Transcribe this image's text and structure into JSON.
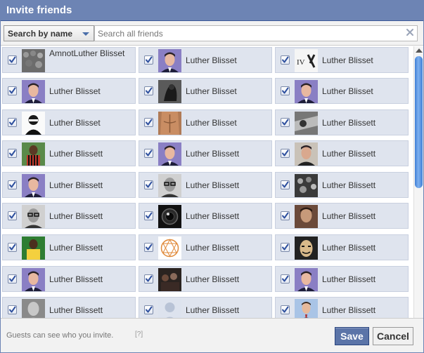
{
  "dialog": {
    "title": "Invite friends"
  },
  "search": {
    "filter_label": "Search by name",
    "placeholder": "Search all friends",
    "value": ""
  },
  "friends": [
    {
      "name": "AmnotLuther Blisset",
      "checked": true,
      "avatar": "crowd-photo"
    },
    {
      "name": "Luther Blisset",
      "checked": true,
      "avatar": "man-portrait"
    },
    {
      "name": "Luther Blisset",
      "checked": true,
      "avatar": "iv-logo"
    },
    {
      "name": "Luther Blisset",
      "checked": true,
      "avatar": "man-portrait"
    },
    {
      "name": "Luther Blisset",
      "checked": true,
      "avatar": "dark-figure"
    },
    {
      "name": "Luther Blisset",
      "checked": true,
      "avatar": "man-portrait"
    },
    {
      "name": "Luther Blisset",
      "checked": true,
      "avatar": "masked-figure"
    },
    {
      "name": "Luther Blisset",
      "checked": true,
      "avatar": "torso-photo"
    },
    {
      "name": "Luther Blissett",
      "checked": true,
      "avatar": "bw-photo"
    },
    {
      "name": "Luther Blissett",
      "checked": true,
      "avatar": "footballer"
    },
    {
      "name": "Luther Blissett",
      "checked": true,
      "avatar": "man-portrait"
    },
    {
      "name": "Luther Blissett",
      "checked": true,
      "avatar": "man-portrait-2"
    },
    {
      "name": "Luther Blissett",
      "checked": true,
      "avatar": "man-portrait"
    },
    {
      "name": "Luther Blissett",
      "checked": true,
      "avatar": "man-glasses"
    },
    {
      "name": "Luther Blissett",
      "checked": true,
      "avatar": "crowd-bw"
    },
    {
      "name": "Luther Blissett",
      "checked": true,
      "avatar": "man-glasses"
    },
    {
      "name": "Luther Blissett",
      "checked": true,
      "avatar": "camera-lens"
    },
    {
      "name": "Luther Blissett",
      "checked": true,
      "avatar": "young-man"
    },
    {
      "name": "Luther Blissett",
      "checked": true,
      "avatar": "footballer-yellow"
    },
    {
      "name": "Luther Blissett",
      "checked": true,
      "avatar": "enneagram"
    },
    {
      "name": "Luther Blissett",
      "checked": true,
      "avatar": "mask"
    },
    {
      "name": "Luther Blissett",
      "checked": true,
      "avatar": "man-portrait"
    },
    {
      "name": "Luther Blissett",
      "checked": true,
      "avatar": "dark-group"
    },
    {
      "name": "Luther Blissett",
      "checked": true,
      "avatar": "man-portrait"
    },
    {
      "name": "Luther Blissett",
      "checked": true,
      "avatar": "statue"
    },
    {
      "name": "Luther Blissett",
      "checked": true,
      "avatar": "silhouette"
    },
    {
      "name": "Luther Blissett",
      "checked": true,
      "avatar": "man-suit"
    }
  ],
  "footer": {
    "note": "Guests can see who you invite.",
    "help": "[?]",
    "save_label": "Save",
    "cancel_label": "Cancel"
  },
  "colors": {
    "header": "#6d84b4",
    "cell_bg": "#dfe4ee",
    "primary_button": "#5b74a8"
  },
  "icons": {
    "checkbox": "checkmark-icon",
    "clear": "clear-icon",
    "dropdown": "chevron-down-icon"
  }
}
